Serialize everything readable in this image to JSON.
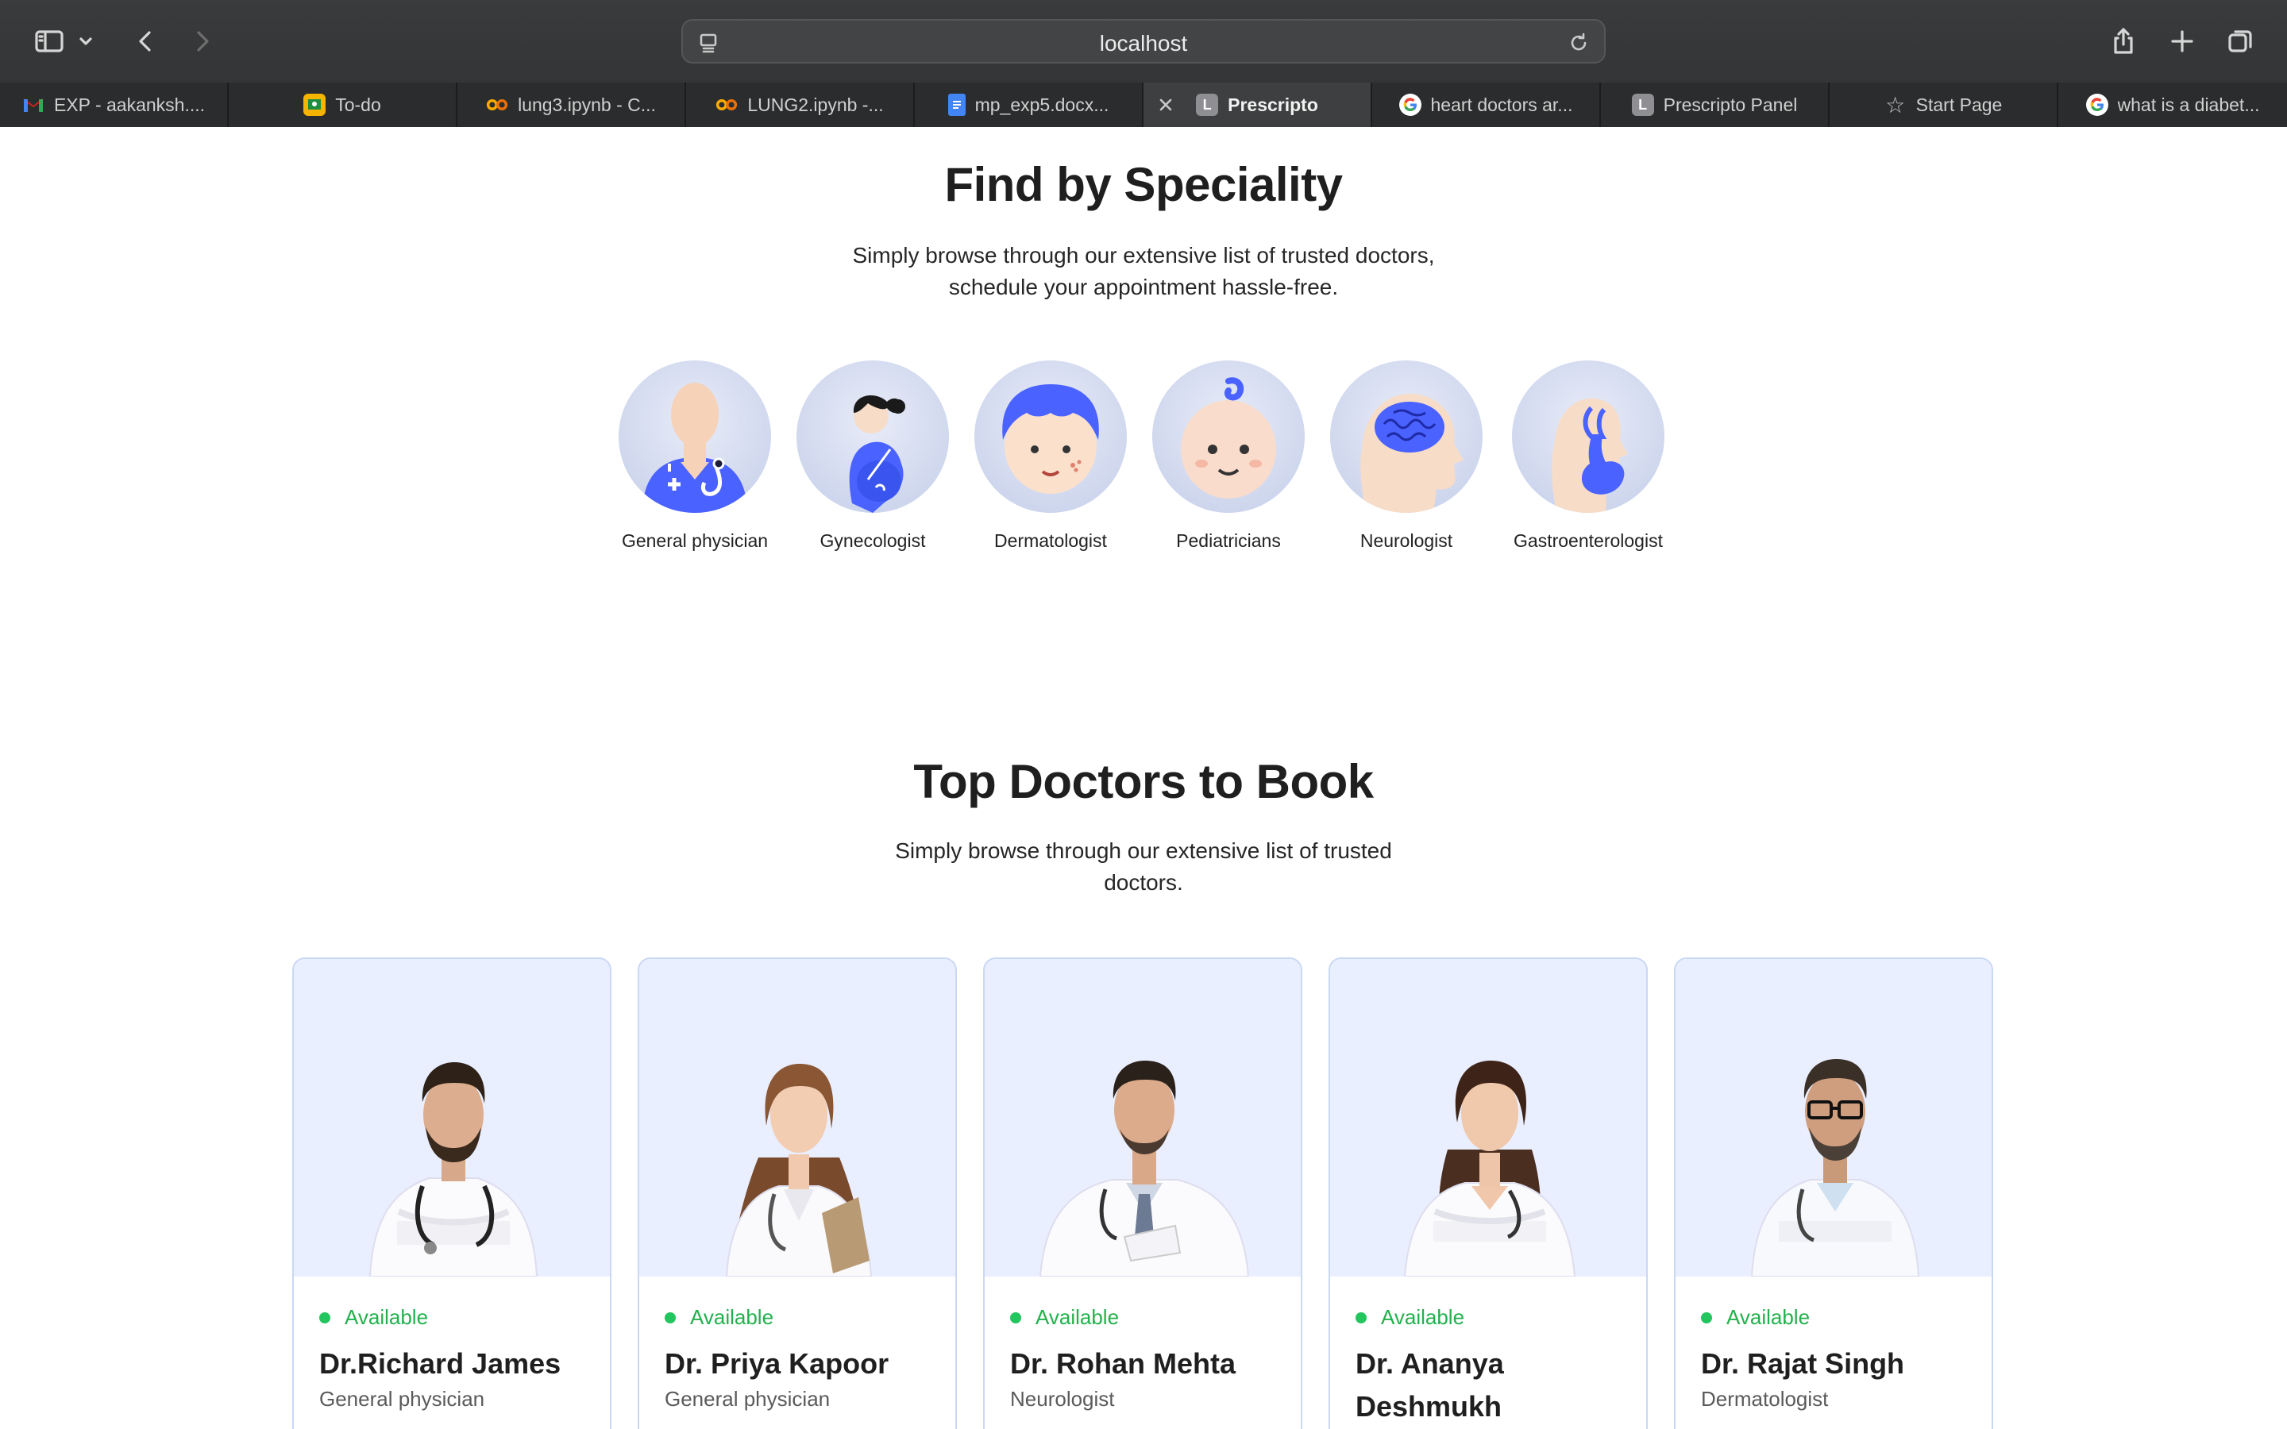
{
  "browser": {
    "address": "localhost",
    "tabs": [
      {
        "label": "EXP - aakanksh....",
        "icon": "gmail-icon",
        "fav_color": "#ea4335",
        "fav_text": "M"
      },
      {
        "label": "To-do",
        "icon": "classroom-icon",
        "fav_color": "#f4b400",
        "fav_text": ""
      },
      {
        "label": "lung3.ipynb - C...",
        "icon": "colab-icon",
        "fav_color": "#f9ab00",
        "fav_text": "co"
      },
      {
        "label": "LUNG2.ipynb -...",
        "icon": "colab-icon",
        "fav_color": "#f9ab00",
        "fav_text": "co"
      },
      {
        "label": "mp_exp5.docx...",
        "icon": "docs-icon",
        "fav_color": "#4285f4",
        "fav_text": ""
      },
      {
        "label": "Prescripto",
        "icon": "letter-l-icon",
        "fav_color": "#8e8e93",
        "fav_text": "L",
        "active": true
      },
      {
        "label": "heart doctors ar...",
        "icon": "google-icon",
        "fav_color": "#ffffff",
        "fav_text": "G"
      },
      {
        "label": "Prescripto Panel",
        "icon": "letter-l-icon",
        "fav_color": "#8e8e93",
        "fav_text": "L"
      },
      {
        "label": "Start Page",
        "icon": "star-icon",
        "fav_color": "",
        "fav_text": "☆"
      },
      {
        "label": "what is a diabet...",
        "icon": "google-icon",
        "fav_color": "#ffffff",
        "fav_text": "G"
      }
    ]
  },
  "speciality": {
    "title": "Find by Speciality",
    "subtitle_line1": "Simply browse through our extensive list of trusted doctors,",
    "subtitle_line2": "schedule your appointment hassle-free.",
    "items": [
      {
        "label": "General physician",
        "icon": "general-physician-icon"
      },
      {
        "label": "Gynecologist",
        "icon": "gynecologist-icon"
      },
      {
        "label": "Dermatologist",
        "icon": "dermatologist-icon"
      },
      {
        "label": "Pediatricians",
        "icon": "pediatrician-icon"
      },
      {
        "label": "Neurologist",
        "icon": "neurologist-icon"
      },
      {
        "label": "Gastroenterologist",
        "icon": "gastroenterologist-icon"
      }
    ]
  },
  "top_doctors": {
    "title": "Top Doctors to Book",
    "subtitle_line1": "Simply browse through our extensive list of trusted",
    "subtitle_line2": "doctors.",
    "doctors": [
      {
        "status": "Available",
        "name": "Dr.Richard James",
        "speciality": "General physician"
      },
      {
        "status": "Available",
        "name": "Dr. Priya Kapoor",
        "speciality": "General physician"
      },
      {
        "status": "Available",
        "name": "Dr. Rohan Mehta",
        "speciality": "Neurologist"
      },
      {
        "status": "Available",
        "name": "Dr. Ananya Deshmukh",
        "speciality": ""
      },
      {
        "status": "Available",
        "name": "Dr. Rajat Singh",
        "speciality": "Dermatologist"
      }
    ]
  },
  "colors": {
    "accent": "#5f6fff",
    "available": "#22c55e",
    "card_bg": "#eaefff"
  }
}
